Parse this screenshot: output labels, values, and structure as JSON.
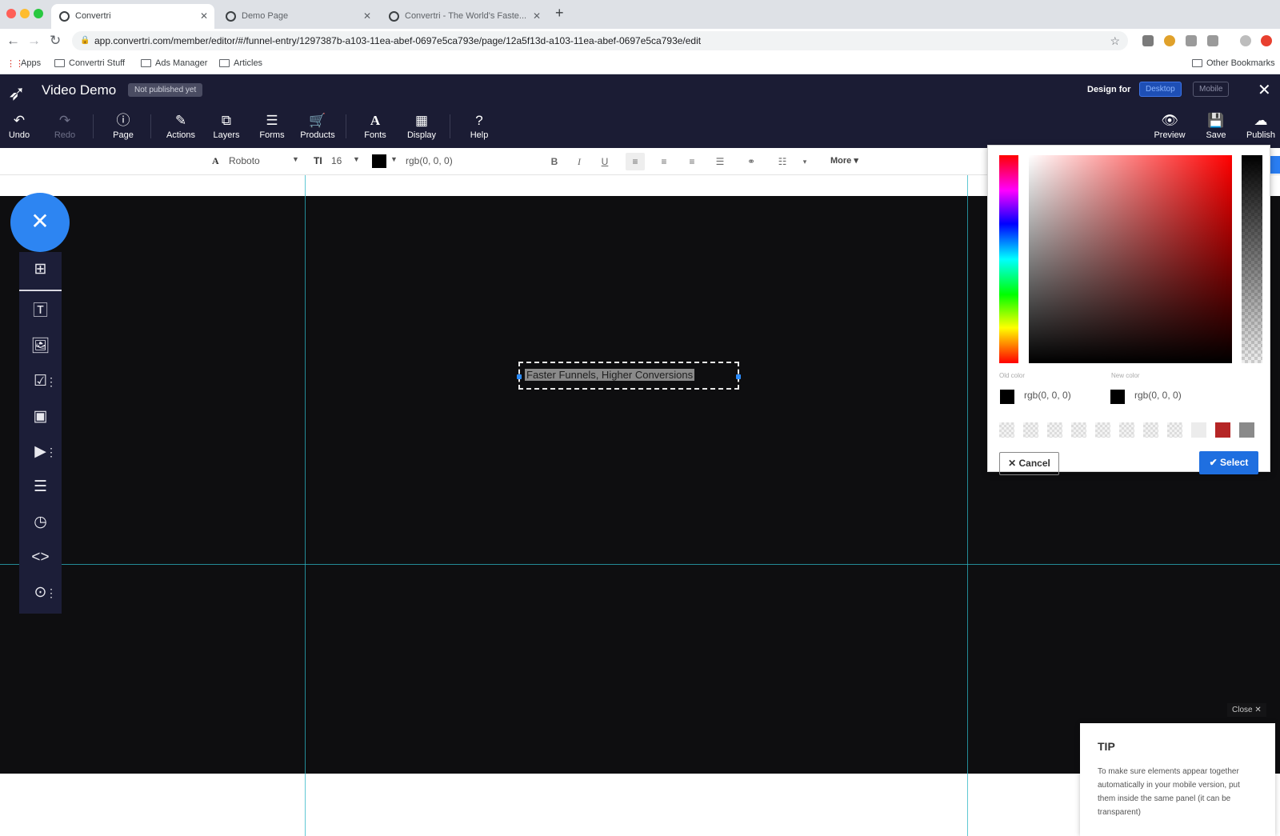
{
  "browser": {
    "tabs": [
      {
        "title": "Convertri"
      },
      {
        "title": "Demo Page"
      },
      {
        "title": "Convertri - The World's Faste..."
      }
    ],
    "url": "app.convertri.com/member/editor/#/funnel-entry/1297387b-a103-11ea-abef-0697e5ca793e/page/12a5f13d-a103-11ea-abef-0697e5ca793e/edit",
    "bookmarks": [
      "Apps",
      "Convertri Stuff",
      "Ads Manager",
      "Articles"
    ],
    "other_bookmarks": "Other Bookmarks"
  },
  "header": {
    "title": "Video Demo",
    "publish_status": "Not published yet",
    "design_for_label": "Design for",
    "design_desktop": "Desktop",
    "design_mobile": "Mobile"
  },
  "toolbar": {
    "undo": "Undo",
    "redo": "Redo",
    "page": "Page",
    "actions": "Actions",
    "layers": "Layers",
    "forms": "Forms",
    "products": "Products",
    "fonts": "Fonts",
    "display": "Display",
    "help": "Help",
    "preview": "Preview",
    "save": "Save",
    "publish": "Publish"
  },
  "format_bar": {
    "font_family": "Roboto",
    "font_size": "16",
    "color_value": "rgb(0, 0, 0)",
    "more_label": "More"
  },
  "canvas": {
    "headline_text": "Faster Funnels, Higher Conversions"
  },
  "color_picker": {
    "old_color_label": "Old color",
    "old_color_value": "rgb(0, 0, 0)",
    "new_color_label": "New color",
    "new_color_value": "rgb(0, 0, 0)",
    "cancel_label": "Cancel",
    "select_label": "Select",
    "preset_colors": [
      "#ececec",
      "#b52525",
      "#8a8a8a"
    ]
  },
  "tip": {
    "close_label": "Close",
    "title": "TIP",
    "body": "To make sure elements appear together automatically in your mobile version, put them inside the same panel (it can be transparent)"
  },
  "colors": {
    "header_bg": "#1b1c34",
    "accent_blue": "#2d85f2",
    "guide_line": "#2bb5c4",
    "canvas_bg": "#0e0e10"
  }
}
